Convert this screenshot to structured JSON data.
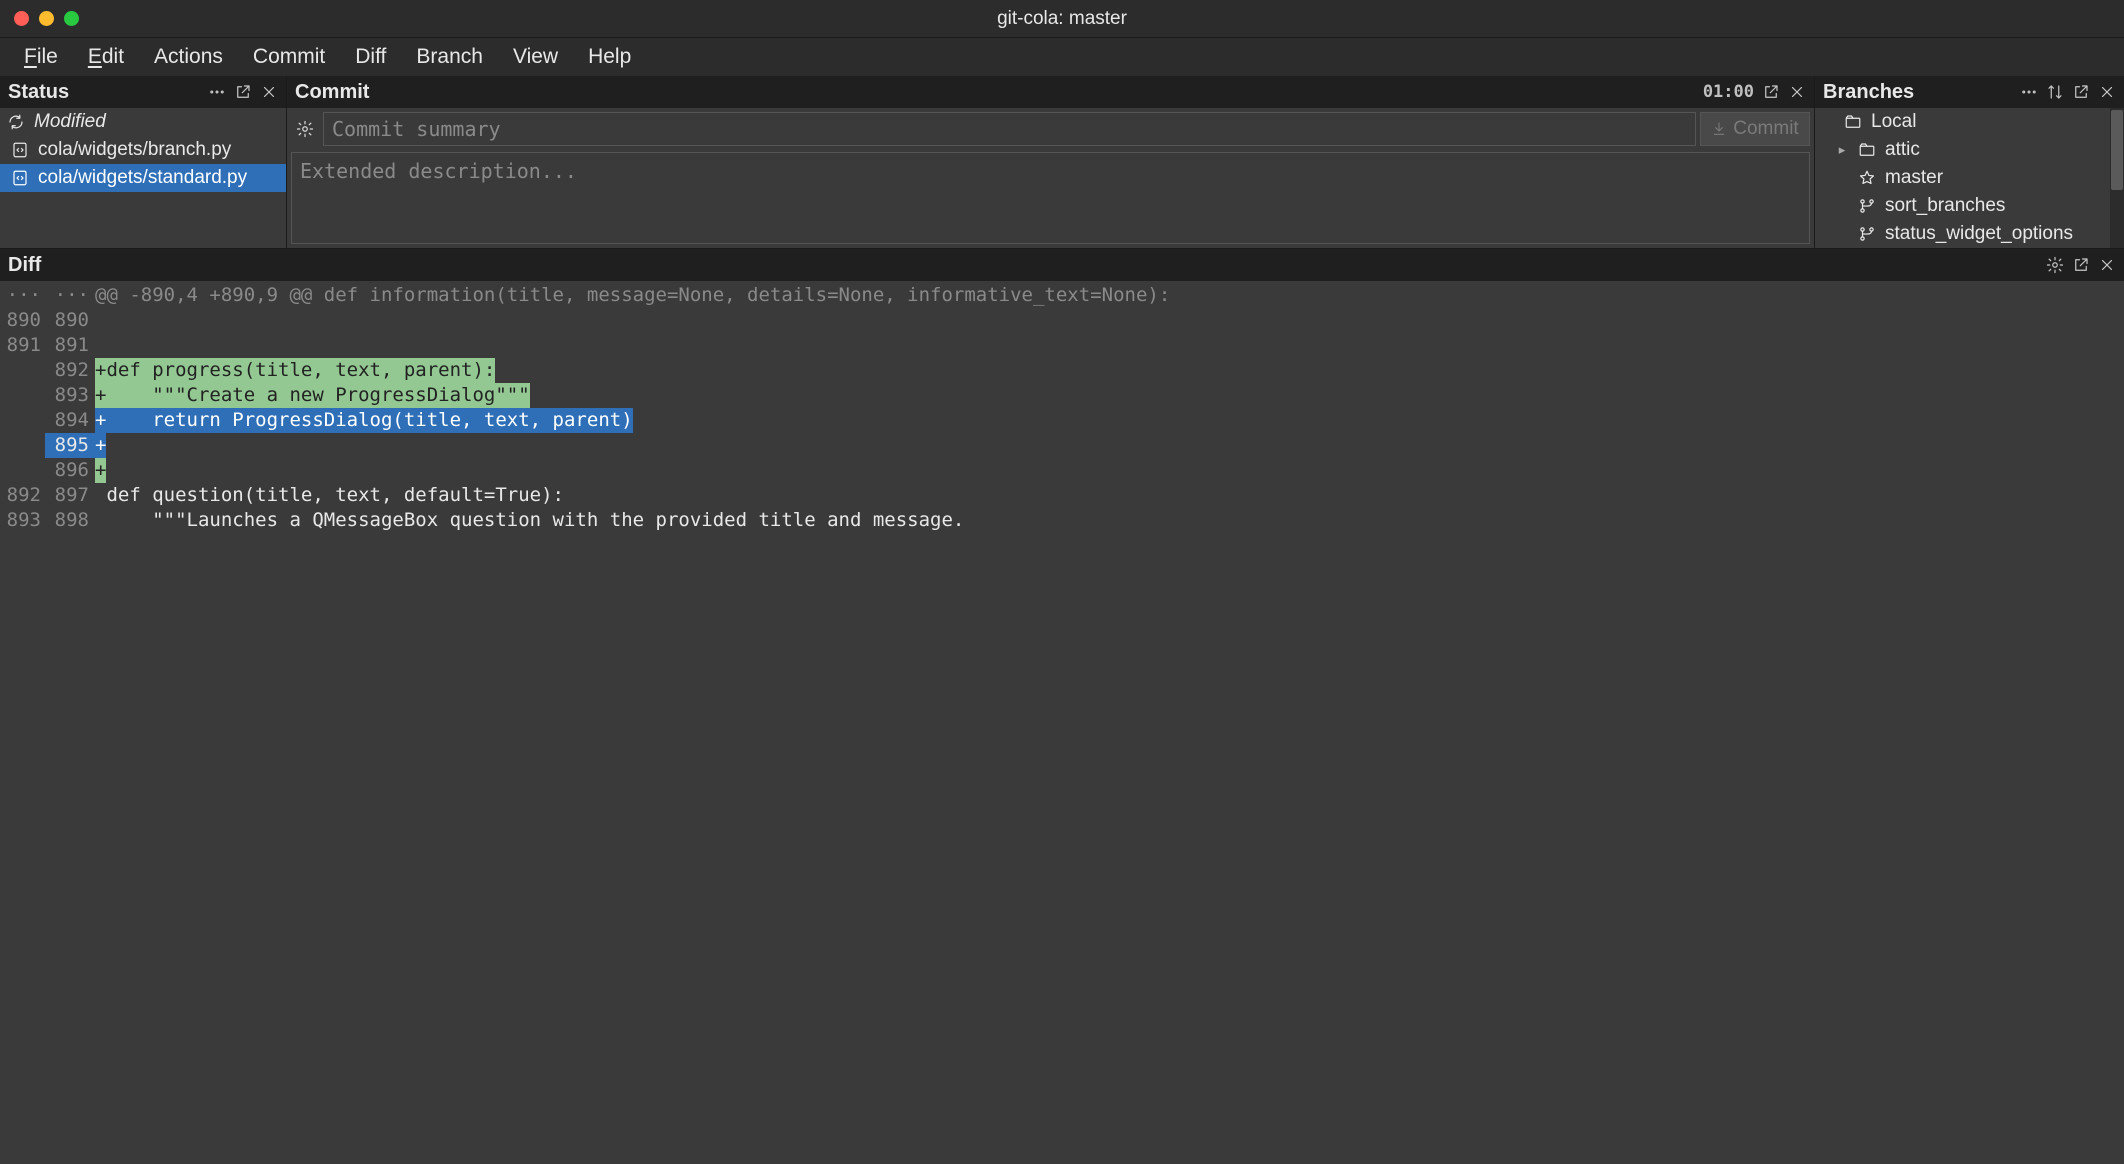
{
  "window": {
    "title": "git-cola: master"
  },
  "menu": {
    "file": "File",
    "edit": "Edit",
    "actions": "Actions",
    "commit": "Commit",
    "diff": "Diff",
    "branch": "Branch",
    "view": "View",
    "help": "Help"
  },
  "panels": {
    "status_title": "Status",
    "commit_title": "Commit",
    "branches_title": "Branches",
    "diff_title": "Diff"
  },
  "status": {
    "group_modified": "Modified",
    "files": [
      {
        "path": "cola/widgets/branch.py",
        "selected": false
      },
      {
        "path": "cola/widgets/standard.py",
        "selected": true
      }
    ]
  },
  "commit": {
    "summary_placeholder": "Commit summary",
    "summary_value": "",
    "desc_placeholder": "Extended description...",
    "desc_value": "",
    "counter": "01:00",
    "commit_button": "Commit"
  },
  "branches": {
    "root": "Local",
    "items": [
      {
        "label": "attic",
        "icon": "folder",
        "expandable": true
      },
      {
        "label": "master",
        "icon": "star",
        "expandable": false
      },
      {
        "label": "sort_branches",
        "icon": "branch",
        "expandable": false
      },
      {
        "label": "status_widget_options",
        "icon": "branch",
        "expandable": false
      }
    ]
  },
  "diff": {
    "lines": [
      {
        "old": "···",
        "new": "···",
        "style": "hunk",
        "text": "@@ -890,4 +890,9 @@ def information(title, message=None, details=None, informative_text=None):"
      },
      {
        "old": "890",
        "new": "890",
        "style": "ctx",
        "text": ""
      },
      {
        "old": "891",
        "new": "891",
        "style": "ctx",
        "text": ""
      },
      {
        "old": "",
        "new": "892",
        "style": "add-green",
        "text": "+def progress(title, text, parent):"
      },
      {
        "old": "",
        "new": "893",
        "style": "add-green",
        "text": "+    \"\"\"Create a new ProgressDialog\"\"\""
      },
      {
        "old": "",
        "new": "894",
        "style": "add-blue",
        "text": "+    return ProgressDialog(title, text, parent)"
      },
      {
        "old": "",
        "new": "895",
        "style": "add-blue-short",
        "text": "+",
        "highlight_row": true
      },
      {
        "old": "",
        "new": "896",
        "style": "add-green-short",
        "text": "+"
      },
      {
        "old": "892",
        "new": "897",
        "style": "ctx",
        "text": " def question(title, text, default=True):"
      },
      {
        "old": "893",
        "new": "898",
        "style": "ctx",
        "text": "     \"\"\"Launches a QMessageBox question with the provided title and message."
      }
    ]
  }
}
